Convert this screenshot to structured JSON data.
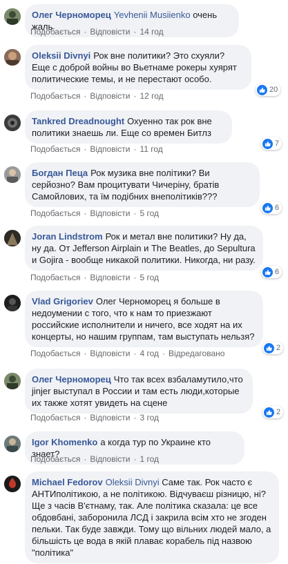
{
  "ui": {
    "like_label": "Подобається",
    "reply_label": "Відповісти",
    "edited_label": "Відредаговано"
  },
  "comments": [
    {
      "author": "Олег Черноморец",
      "mention": "Yevhenii Musiienko",
      "text": "очень жаль",
      "time": "14 год",
      "reactions": null
    },
    {
      "author": "Oleksii Divnyi",
      "mention": "",
      "text": "Рок вне политики? Это схуяли? Еще с доброй войны во Вьетнаме рокеры хуярят политические темы, и не перестают особо.",
      "time": "12 год",
      "reactions": "20"
    },
    {
      "author": "Tankred Dreadnought",
      "mention": "",
      "text": "Охуенно так рок вне политики знаешь ли. Еще со времен Битлз",
      "time": "11 год",
      "reactions": "7"
    },
    {
      "author": "Богдан Пеца",
      "mention": "",
      "text": "Рок музика вне політики? Ви серйозно? Вам процитувати Чичеріну, братів Самойлових, та їм подібних внеполітиків???",
      "time": "5 год",
      "reactions": "6"
    },
    {
      "author": "Joran Lindstrom",
      "mention": "",
      "text": "Рок и метал вне политики? Ну да, ну да. От Jefferson Airplain и The Beatles, до Sepultura и Gojira - вообще никакой политики. Никогда, ни разу.",
      "time": "5 год",
      "reactions": "6"
    },
    {
      "author": "Vlad Grigoriev",
      "mention": "",
      "text": "Олег Черноморец я больше в недоумении с того, что к нам то приезжают российские исполнители и ничего, все ходят на их концерты, но нашим группам, там выступать нельзя?",
      "time": "4 год",
      "edited": true,
      "reactions": "2"
    },
    {
      "author": "Олег Черноморец",
      "mention": "",
      "text": "Что так всех взбаламутило,что jinjer выступал в России и там есть люди,которые их также хотят увидеть на сцене",
      "time": "3 год",
      "reactions": "2"
    },
    {
      "author": "Igor Khomenko",
      "mention": "",
      "text": "а когда тур по Украине кто знает?",
      "time": "1 год",
      "reactions": null
    },
    {
      "author": "Michael Fedorov",
      "mention": "Oleksii Divnyi",
      "text": "Саме так. Рок часто є АНТИполітикою, а не політикою. Відчуваєш різницю, ні? Ще з часів В'єтнаму, так. Але політика сказала: це все обдовбані, заборонила ЛСД і закрила всім хто не згоден пельки. Так буде завжди. Тому що вільних людей мало, а більшість це вода в якій плаває корабель під назвою \"політика\"",
      "time": "",
      "reactions": null
    }
  ],
  "colors": {
    "link": "#385898",
    "bubble": "#f0f2f5",
    "like_blue": "#1877f2",
    "meta": "#65676b"
  }
}
